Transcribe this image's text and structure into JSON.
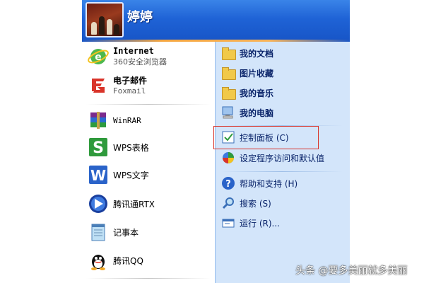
{
  "user": {
    "name": "婷婷"
  },
  "pinned": [
    {
      "title": "Internet",
      "subtitle": "360安全浏览器",
      "icon": "ie-icon"
    },
    {
      "title": "电子邮件",
      "subtitle": "Foxmail",
      "icon": "foxmail-icon"
    }
  ],
  "programs": [
    {
      "label": "WinRAR",
      "icon": "winrar-icon"
    },
    {
      "label": "WPS表格",
      "icon": "wps-spreadsheet-icon"
    },
    {
      "label": "WPS文字",
      "icon": "wps-writer-icon"
    },
    {
      "label": "腾讯通RTX",
      "icon": "rtx-icon"
    },
    {
      "label": "记事本",
      "icon": "notepad-icon"
    },
    {
      "label": "腾讯QQ",
      "icon": "qq-icon"
    }
  ],
  "places": [
    {
      "label": "我的文档",
      "icon": "my-documents-icon"
    },
    {
      "label": "图片收藏",
      "icon": "my-pictures-icon"
    },
    {
      "label": "我的音乐",
      "icon": "my-music-icon"
    },
    {
      "label": "我的电脑",
      "icon": "my-computer-icon"
    },
    {
      "label": "控制面板 (C)",
      "icon": "control-panel-icon"
    },
    {
      "label": "设定程序访问和默认值",
      "icon": "program-access-icon"
    },
    {
      "label": "帮助和支持 (H)",
      "icon": "help-icon"
    },
    {
      "label": "搜索 (S)",
      "icon": "search-icon"
    },
    {
      "label": "运行 (R)...",
      "icon": "run-icon"
    }
  ],
  "watermark": "头条 @要多美丽就多美丽",
  "colors": {
    "header": "#1f63d6",
    "right_pane": "#d3e5fa",
    "highlight": "#d9342a",
    "link": "#0a246a"
  }
}
